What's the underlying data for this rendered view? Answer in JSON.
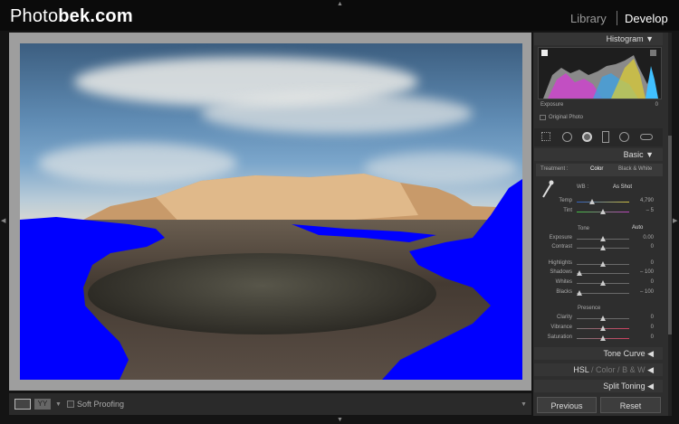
{
  "app": {
    "logo_light": "Photo",
    "logo_bold": "bek.com",
    "module_library": "Library",
    "module_develop": "Develop"
  },
  "toolbar": {
    "soft_proofing": "Soft Proofing",
    "view_mode": "YY"
  },
  "histogram": {
    "title": "Histogram",
    "exposure_label": "Exposure",
    "exposure_value": "0",
    "original_photo": "Original Photo"
  },
  "basic": {
    "title": "Basic",
    "treatment_label": "Treatment :",
    "color": "Color",
    "bw": "Black & White",
    "wb_label": "WB :",
    "wb_value": "As Shot",
    "temp_label": "Temp",
    "temp_value": "4,790",
    "tint_label": "Tint",
    "tint_value": "– 5",
    "tone_label": "Tone",
    "auto": "Auto",
    "exposure_label": "Exposure",
    "exposure_value": "0.00",
    "contrast_label": "Contrast",
    "contrast_value": "0",
    "highlights_label": "Highlights",
    "highlights_value": "0",
    "shadows_label": "Shadows",
    "shadows_value": "– 100",
    "whites_label": "Whites",
    "whites_value": "0",
    "blacks_label": "Blacks",
    "blacks_value": "– 100",
    "presence_label": "Presence",
    "clarity_label": "Clarity",
    "clarity_value": "0",
    "vibrance_label": "Vibrance",
    "vibrance_value": "0",
    "saturation_label": "Saturation",
    "saturation_value": "0"
  },
  "sections": {
    "tone_curve": "Tone Curve",
    "hsl": "HSL",
    "hsl_sep1": "/",
    "color": "Color",
    "hsl_sep2": "/",
    "bw": "B & W",
    "split_toning": "Split Toning"
  },
  "buttons": {
    "previous": "Previous",
    "reset": "Reset"
  }
}
